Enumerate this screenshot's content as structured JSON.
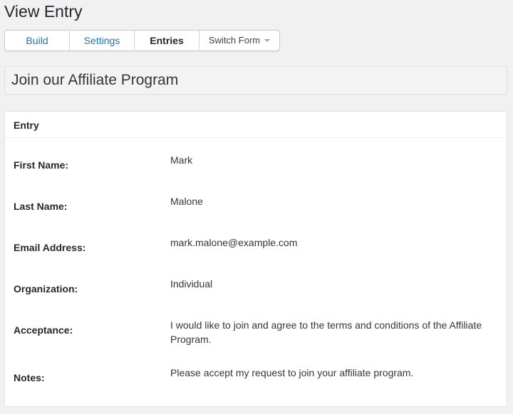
{
  "page": {
    "title": "View Entry"
  },
  "tabs": [
    {
      "label": "Build"
    },
    {
      "label": "Settings"
    },
    {
      "label": "Entries"
    },
    {
      "label": "Switch Form"
    }
  ],
  "form": {
    "title": "Join our Affiliate Program"
  },
  "entry": {
    "header": "Entry",
    "fields": [
      {
        "label": "First Name:",
        "value": "Mark"
      },
      {
        "label": "Last Name:",
        "value": "Malone"
      },
      {
        "label": "Email Address:",
        "value": "mark.malone@example.com"
      },
      {
        "label": "Organization:",
        "value": "Individual"
      },
      {
        "label": "Acceptance:",
        "value": "I would like to join and agree to the terms and conditions of the Affiliate Program."
      },
      {
        "label": "Notes:",
        "value": "Please accept my request to join your affiliate program."
      }
    ]
  },
  "colors": {
    "link": "#2271b1",
    "text": "#23282d",
    "background": "#f1f1f1"
  }
}
